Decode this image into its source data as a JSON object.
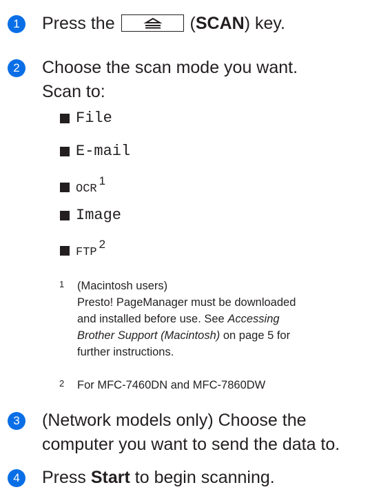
{
  "steps": [
    {
      "number": "1",
      "before": "Press the",
      "key_label_prefix": "(",
      "key_label_bold": "SCAN",
      "key_label_suffix": ") key."
    },
    {
      "number": "2",
      "line1": "Choose the scan mode you want.",
      "line2": "Scan to:"
    },
    {
      "number": "3",
      "line1": "(Network models only) Choose the",
      "line2": "computer you want to send the data to."
    },
    {
      "number": "4",
      "before": "Press",
      "bold": "Start",
      "after": "to begin scanning."
    }
  ],
  "scan_options": [
    {
      "label": "File",
      "sup": ""
    },
    {
      "label": "E-mail",
      "sup": ""
    },
    {
      "label": "OCR",
      "sup": "1"
    },
    {
      "label": "Image",
      "sup": ""
    },
    {
      "label": "FTP",
      "sup": "2"
    }
  ],
  "footnotes": [
    {
      "number": "1",
      "line1": "(Macintosh users)",
      "line2": "Presto! PageManager must be downloaded",
      "line3": "and installed before use. See",
      "line3_italic": "Accessing",
      "line4_italic": "Brother Support (Macintosh)",
      "line4": "on page 5 for",
      "line5": "further instructions."
    },
    {
      "number": "2",
      "line1": "For MFC-7460DN and MFC-7860DW"
    }
  ],
  "colors": {
    "badge": "#0a6fe6",
    "text": "#231f20"
  },
  "icons": {
    "scan_key": "scan-tray-icon"
  }
}
